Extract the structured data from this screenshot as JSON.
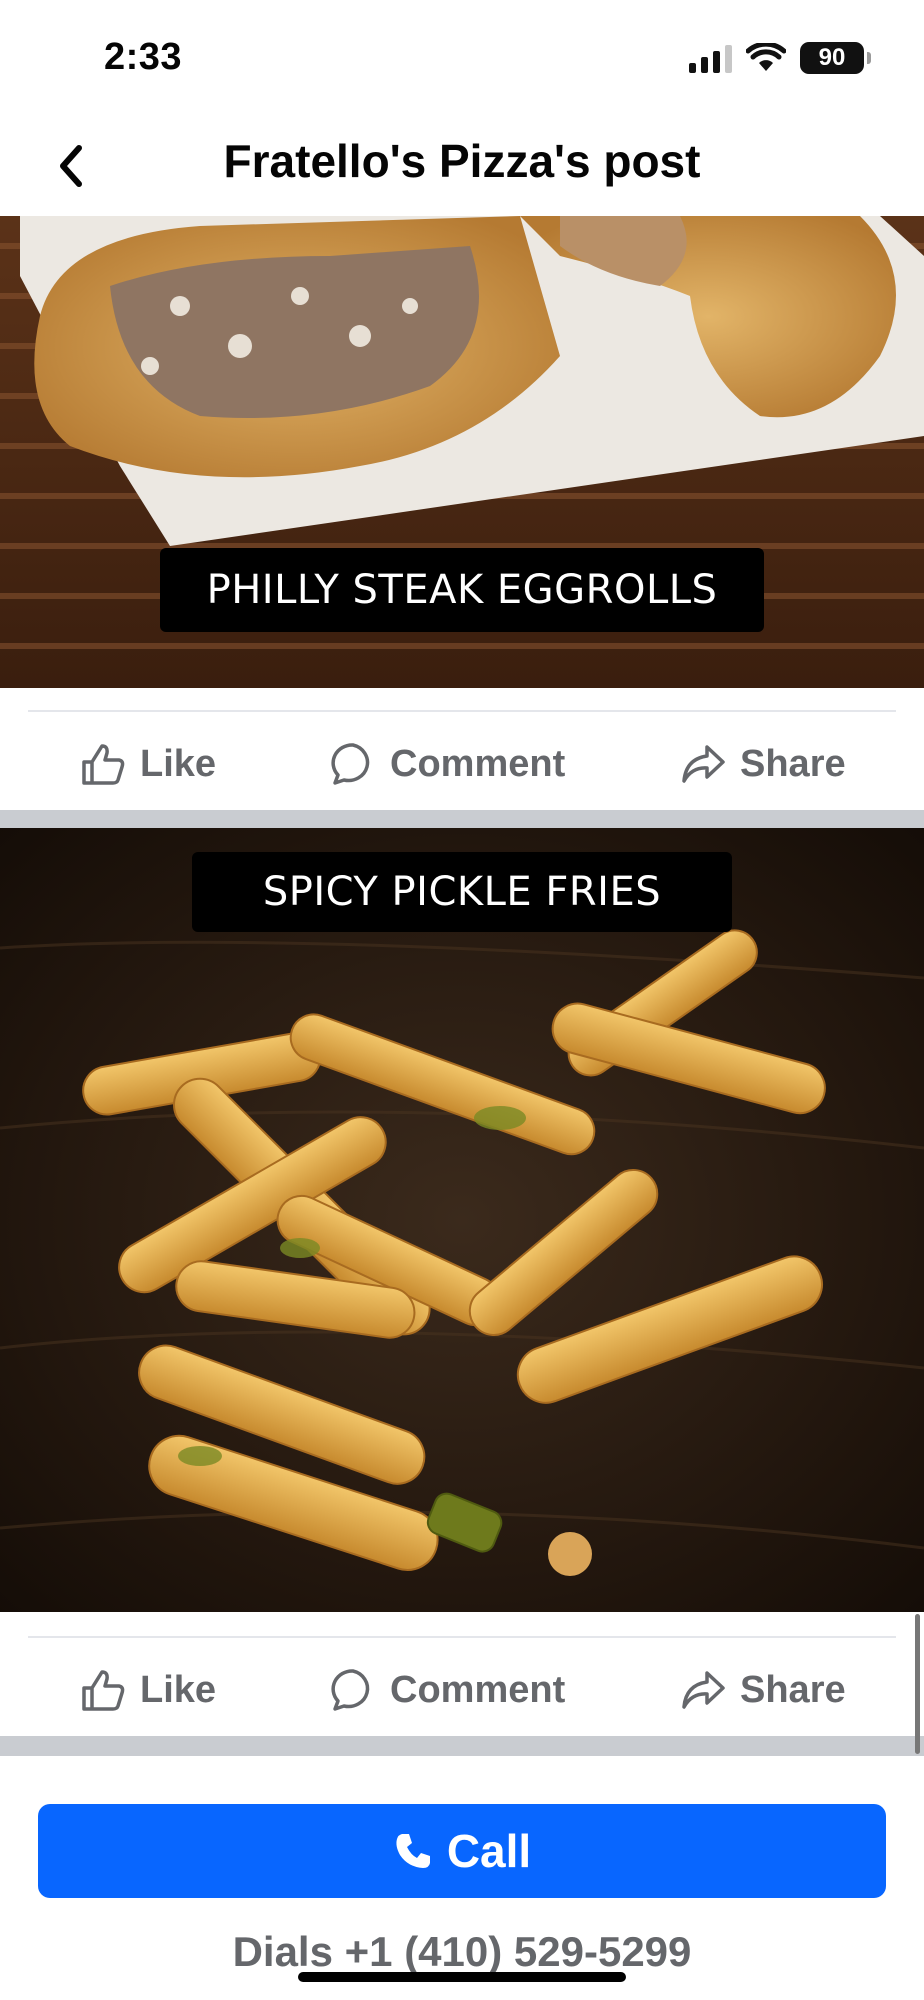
{
  "status_bar": {
    "time": "2:33",
    "battery": "90",
    "icons": [
      "cellular-signal-icon",
      "wifi-icon",
      "battery-icon"
    ]
  },
  "header": {
    "title": "Fratello's Pizza's post",
    "back_icon": "chevron-left-icon"
  },
  "posts": [
    {
      "caption": "PHILLY STEAK EGGROLLS",
      "actions": {
        "like": "Like",
        "comment": "Comment",
        "share": "Share"
      }
    },
    {
      "caption": "SPICY PICKLE FRIES",
      "actions": {
        "like": "Like",
        "comment": "Comment",
        "share": "Share"
      }
    }
  ],
  "cta": {
    "call_label": "Call",
    "dials_text": "Dials +1 (410) 529-5299"
  },
  "colors": {
    "brand_blue": "#0866ff",
    "action_gray": "#65676b",
    "separator": "#c9ccd1"
  }
}
